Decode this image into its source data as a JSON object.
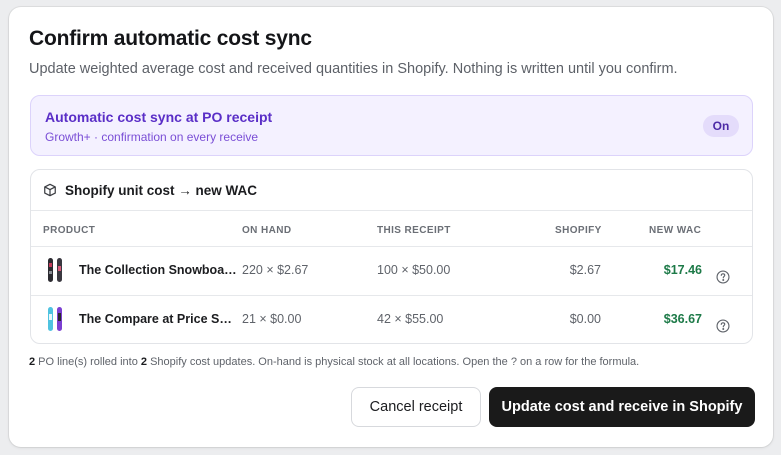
{
  "modal": {
    "title": "Confirm automatic cost sync",
    "subtitle": "Update weighted average cost and received quantities in Shopify. Nothing is written until you confirm."
  },
  "banner": {
    "title": "Automatic cost sync at PO receipt",
    "subtitle": "Growth+ · confirmation on every receive",
    "status": "On"
  },
  "card": {
    "icon": "cube-icon",
    "title": "Shopify unit cost → new WAC",
    "columns": [
      "PRODUCT",
      "ON HAND",
      "THIS RECEIPT",
      "SHOPIFY",
      "NEW WAC"
    ],
    "rows": [
      {
        "product": "The Collection Snowboard: Hydrogen",
        "thumb_icon": "snowboard-dark-icon",
        "on_hand": "220 × $2.67",
        "this_receipt": "100 × $50.00",
        "shopify": "$2.67",
        "new_wac": "$17.46"
      },
      {
        "product": "The Compare at Price Snowboard",
        "thumb_icon": "snowboard-blue-icon",
        "on_hand": "21 × $0.00",
        "this_receipt": "42 × $55.00",
        "shopify": "$0.00",
        "new_wac": "$36.67"
      }
    ]
  },
  "footnote": {
    "po_lines": "2",
    "text_a": " PO line(s) rolled into ",
    "updates": "2",
    "text_b": " Shopify cost updates. On-hand is physical stock at all locations. Open the ? on a row for the formula."
  },
  "actions": {
    "cancel_label": "Cancel receipt",
    "confirm_label": "Update cost and receive in Shopify"
  },
  "colors": {
    "accent_purple": "#5a2ec7",
    "wac_green": "#1d7a48",
    "primary_button": "#1a1a1a"
  }
}
